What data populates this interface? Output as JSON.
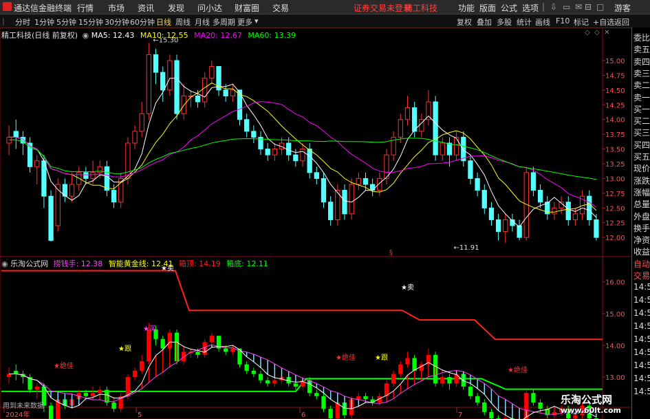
{
  "topbar": {
    "app_title": "通达信金融终端",
    "menus": [
      "行情",
      "市场",
      "资讯",
      "发现",
      "问小达",
      "财富圈",
      "交易"
    ],
    "notice": "证券交易未登录",
    "stock": "精工科技",
    "right_menus": [
      "功能",
      "版面",
      "公式",
      "选项"
    ],
    "guest": "游客",
    "colors": {
      "notice": "#ff4040"
    }
  },
  "periodbar": {
    "periods": [
      "分时",
      "1分钟",
      "5分钟",
      "15分钟",
      "30分钟",
      "60分钟",
      "日线",
      "周线",
      "月线",
      "多周期",
      "更多"
    ],
    "active": "日线",
    "tools": [
      "复权",
      "叠加",
      "多股",
      "统计",
      "画线",
      "F10",
      "标记",
      "+自选",
      "返回"
    ]
  },
  "main_legend": {
    "title": "精工科技(日线 前复权)",
    "ma5": "MA5: 12.43",
    "ma10": "MA10: 12.55",
    "ma20": "MA20: 12.67",
    "ma60": "MA60: 13.39"
  },
  "indicator_legend": {
    "title": "乐淘公式网",
    "l1": "捞钱手: 12.38",
    "l2": "智能黄金线: 12.41",
    "l3": "箱顶: 14.19",
    "l4": "箱底: 12.11"
  },
  "right_panel": [
    "委比",
    "卖五",
    "卖四",
    "卖三",
    "卖二",
    "卖一",
    "买一",
    "买二",
    "买三",
    "买四",
    "买五",
    "现价",
    "涨跌",
    "涨幅",
    "总量",
    "外盘",
    "换手",
    "净资",
    "收益",
    "自动",
    "交易"
  ],
  "right_panel_lower": [
    "14:5",
    "14:5",
    "14:5",
    "14:5",
    "14:5",
    "14:5",
    "14:5",
    "14:5",
    "14:5"
  ],
  "watermark": {
    "title": "乐淘公式网",
    "url": "www.60lt.com"
  },
  "footer": {
    "note": "用到未来数据"
  },
  "colors": {
    "up": "#ff3232",
    "down": "#54ffff",
    "ma5": "#ffffff",
    "ma10": "#ffff00",
    "ma20": "#ff00ff",
    "ma60": "#00ff00",
    "box_top": "#ff2020",
    "box_bottom": "#00ff00",
    "ind_up": "#ff0000",
    "ind_down": "#00ff00",
    "ind_hatch": "#7fdcff",
    "ind_line": "#ff40ff"
  },
  "chart_data": [
    {
      "type": "candlestick",
      "y_axis_ticks": [
        "15.00",
        "14.75",
        "14.50",
        "14.25",
        "14.00",
        "13.75",
        "13.50",
        "13.25",
        "13.00",
        "12.75",
        "12.50",
        "12.25",
        "12.00"
      ],
      "ylim": [
        11.85,
        15.35
      ],
      "x_axis_labels": [
        "2024年",
        "5",
        "6",
        "7"
      ],
      "annotations": [
        {
          "text": "15.30",
          "value": 15.3,
          "index": 20
        },
        {
          "text": "11.91",
          "value": 11.91,
          "index": 63
        }
      ],
      "candles": [
        [
          13.6,
          13.7,
          13.9,
          13.4
        ],
        [
          13.8,
          13.7,
          14.0,
          13.5
        ],
        [
          13.7,
          13.6,
          13.8,
          13.4
        ],
        [
          13.6,
          13.2,
          13.7,
          13.1
        ],
        [
          13.2,
          13.3,
          13.4,
          12.9
        ],
        [
          13.3,
          12.7,
          13.4,
          12.5
        ],
        [
          12.7,
          11.95,
          12.8,
          11.93
        ],
        [
          12.2,
          12.9,
          13.0,
          12.1
        ],
        [
          12.9,
          12.7,
          13.0,
          12.6
        ],
        [
          12.7,
          12.9,
          13.1,
          12.6
        ],
        [
          12.9,
          13.1,
          13.2,
          12.8
        ],
        [
          13.1,
          13.0,
          13.2,
          12.9
        ],
        [
          13.0,
          13.1,
          13.3,
          12.9
        ],
        [
          13.1,
          13.2,
          13.3,
          13.0
        ],
        [
          13.2,
          12.8,
          13.3,
          12.7
        ],
        [
          12.8,
          12.6,
          12.9,
          12.5
        ],
        [
          12.6,
          13.0,
          13.1,
          12.5
        ],
        [
          13.0,
          13.6,
          13.7,
          12.9
        ],
        [
          13.6,
          13.8,
          13.9,
          13.5
        ],
        [
          13.8,
          14.1,
          14.3,
          13.7
        ],
        [
          14.1,
          15.1,
          15.3,
          14.0
        ],
        [
          15.1,
          14.8,
          15.2,
          14.6
        ],
        [
          14.8,
          14.5,
          14.9,
          14.3
        ],
        [
          14.5,
          15.0,
          15.1,
          14.4
        ],
        [
          15.0,
          14.1,
          15.1,
          14.0
        ],
        [
          14.1,
          14.4,
          14.6,
          14.0
        ],
        [
          14.4,
          14.4,
          14.5,
          14.2
        ],
        [
          14.4,
          14.3,
          14.5,
          14.2
        ],
        [
          14.3,
          14.7,
          14.8,
          14.2
        ],
        [
          14.7,
          14.9,
          15.0,
          14.6
        ],
        [
          14.9,
          14.5,
          14.9,
          14.4
        ],
        [
          14.5,
          14.4,
          14.6,
          14.3
        ],
        [
          14.4,
          14.5,
          14.6,
          14.3
        ],
        [
          14.5,
          14.0,
          14.5,
          13.9
        ],
        [
          14.0,
          13.8,
          14.1,
          13.7
        ],
        [
          13.8,
          13.7,
          13.9,
          13.6
        ],
        [
          13.7,
          13.5,
          13.8,
          13.4
        ],
        [
          13.5,
          13.4,
          13.6,
          13.3
        ],
        [
          13.4,
          13.5,
          13.6,
          13.3
        ],
        [
          13.5,
          13.6,
          13.7,
          13.4
        ],
        [
          13.6,
          13.4,
          13.7,
          13.3
        ],
        [
          13.4,
          13.3,
          13.5,
          13.2
        ],
        [
          13.3,
          13.5,
          13.6,
          13.2
        ],
        [
          13.5,
          13.1,
          13.6,
          13.0
        ],
        [
          13.1,
          13.0,
          13.2,
          12.9
        ],
        [
          13.0,
          12.6,
          13.1,
          12.5
        ],
        [
          12.6,
          12.3,
          12.7,
          12.2
        ],
        [
          12.3,
          12.8,
          12.9,
          12.2
        ],
        [
          12.8,
          12.4,
          12.9,
          12.3
        ],
        [
          12.4,
          12.9,
          13.0,
          12.3
        ],
        [
          12.9,
          13.0,
          13.1,
          12.8
        ],
        [
          13.0,
          12.9,
          13.1,
          12.8
        ],
        [
          12.9,
          12.8,
          13.0,
          12.7
        ],
        [
          12.8,
          13.0,
          13.1,
          12.7
        ],
        [
          13.0,
          13.4,
          13.5,
          12.9
        ],
        [
          13.4,
          13.7,
          13.8,
          13.3
        ],
        [
          13.7,
          14.0,
          14.1,
          13.6
        ],
        [
          14.0,
          14.2,
          14.4,
          13.9
        ],
        [
          14.2,
          13.8,
          14.3,
          13.7
        ],
        [
          13.8,
          14.0,
          14.1,
          13.7
        ],
        [
          14.0,
          14.3,
          14.5,
          13.9
        ],
        [
          14.3,
          13.4,
          14.4,
          13.3
        ],
        [
          13.4,
          13.6,
          13.7,
          13.3
        ],
        [
          13.6,
          13.4,
          13.7,
          13.2
        ],
        [
          13.4,
          13.7,
          13.8,
          13.3
        ],
        [
          13.7,
          13.3,
          13.8,
          13.2
        ],
        [
          13.3,
          13.0,
          13.4,
          12.9
        ],
        [
          13.0,
          12.8,
          13.1,
          12.7
        ],
        [
          12.8,
          12.5,
          12.9,
          12.4
        ],
        [
          12.5,
          12.3,
          12.6,
          12.2
        ],
        [
          12.3,
          12.1,
          12.4,
          11.95
        ],
        [
          12.1,
          12.3,
          12.4,
          11.91
        ],
        [
          12.3,
          12.2,
          12.4,
          12.1
        ],
        [
          12.2,
          12.0,
          12.3,
          11.95
        ],
        [
          12.0,
          13.1,
          13.2,
          11.95
        ],
        [
          13.1,
          12.8,
          13.2,
          12.7
        ],
        [
          12.8,
          12.6,
          12.9,
          12.5
        ],
        [
          12.6,
          12.4,
          12.7,
          12.3
        ],
        [
          12.4,
          12.5,
          12.6,
          12.3
        ],
        [
          12.5,
          12.6,
          12.7,
          12.4
        ],
        [
          12.6,
          12.3,
          12.7,
          12.2
        ],
        [
          12.3,
          12.4,
          12.5,
          12.2
        ],
        [
          12.4,
          12.7,
          12.8,
          12.3
        ],
        [
          12.7,
          12.3,
          12.8,
          12.2
        ],
        [
          12.3,
          12.0,
          12.4,
          11.95
        ]
      ]
    },
    {
      "type": "indicator",
      "y_axis_ticks": [
        "16.00",
        "15.00",
        "14.00",
        "13.00"
      ],
      "ylim": [
        12.2,
        16.6
      ],
      "annotations": [
        "★卖",
        "★卖",
        "★买",
        "★跟",
        "★跟",
        "★绝佳",
        "★绝佳",
        "★绝佳"
      ]
    }
  ]
}
